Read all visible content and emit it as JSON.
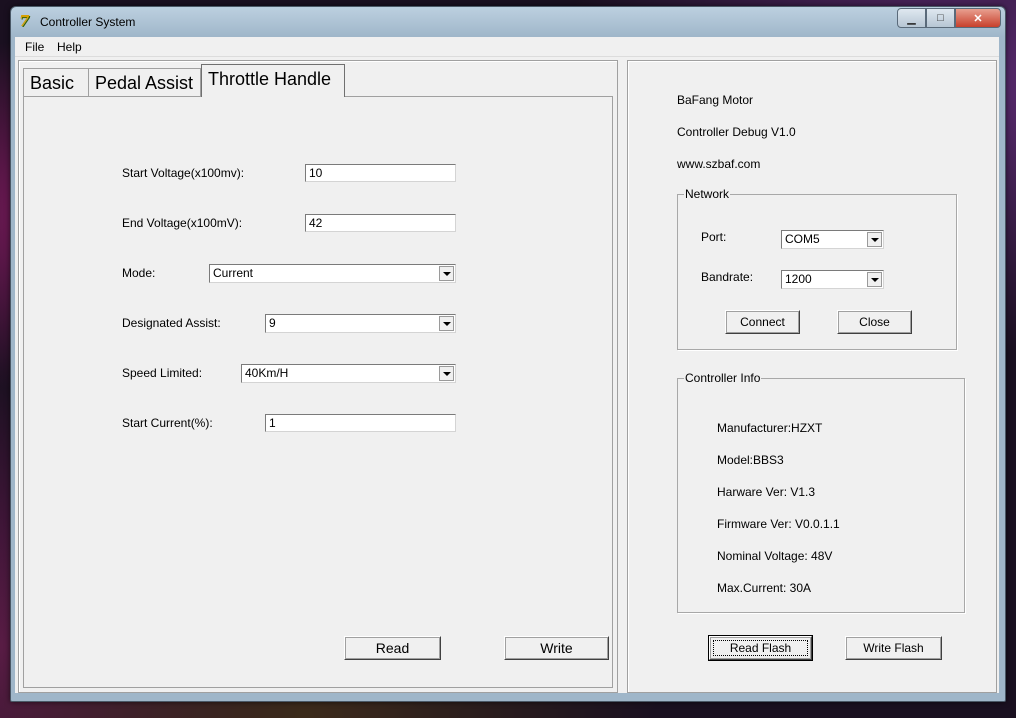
{
  "window": {
    "title": "Controller System"
  },
  "menu": {
    "file": "File",
    "help": "Help"
  },
  "tabs": [
    "Basic",
    "Pedal Assist",
    "Throttle Handle"
  ],
  "throttle": {
    "start_voltage_label": "Start Voltage(x100mv):",
    "start_voltage_value": "10",
    "end_voltage_label": "End Voltage(x100mV):",
    "end_voltage_value": "42",
    "mode_label": "Mode:",
    "mode_value": "Current",
    "designated_assist_label": "Designated Assist:",
    "designated_assist_value": "9",
    "speed_limited_label": "Speed Limited:",
    "speed_limited_value": "40Km/H",
    "start_current_label": "Start Current(%):",
    "start_current_value": "1",
    "read_button": "Read",
    "write_button": "Write"
  },
  "info": {
    "company": "BaFang Motor",
    "app_version": "Controller Debug V1.0",
    "website": "www.szbaf.com"
  },
  "network": {
    "title": "Network",
    "port_label": "Port:",
    "port_value": "COM5",
    "bandrate_label": "Bandrate:",
    "bandrate_value": "1200",
    "connect_button": "Connect",
    "close_button": "Close"
  },
  "controller_info": {
    "title": "Controller Info",
    "manufacturer": "Manufacturer:HZXT",
    "model": "Model:BBS3",
    "hardware_ver": "Harware Ver: V1.3",
    "firmware_ver": "Firmware Ver: V0.0.1.1",
    "nominal_voltage": "Nominal Voltage: 48V",
    "max_current": "Max.Current: 30A"
  },
  "flash": {
    "read_button": "Read Flash",
    "write_button": "Write Flash"
  }
}
